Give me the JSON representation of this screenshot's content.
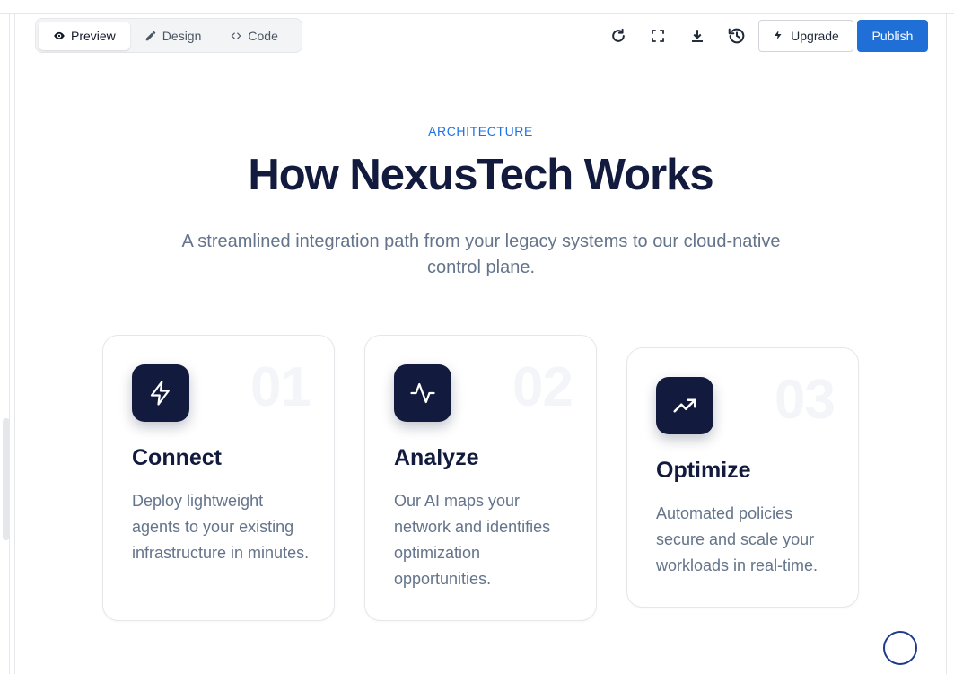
{
  "toolbar": {
    "tabs": [
      {
        "label": "Preview",
        "icon": "eye-icon",
        "active": true
      },
      {
        "label": "Design",
        "icon": "pencil-icon",
        "active": false
      },
      {
        "label": "Code",
        "icon": "code-icon",
        "active": false
      }
    ],
    "actions": [
      "refresh-icon",
      "fullscreen-icon",
      "download-icon",
      "history-icon"
    ],
    "upgrade_label": "Upgrade",
    "publish_label": "Publish"
  },
  "section": {
    "eyebrow": "ARCHITECTURE",
    "title": "How NexusTech Works",
    "subtitle": "A streamlined integration path from your legacy systems to our cloud-native control plane."
  },
  "steps": [
    {
      "number": "01",
      "icon": "lightning-icon",
      "title": "Connect",
      "body": "Deploy lightweight agents to your existing infrastructure in minutes."
    },
    {
      "number": "02",
      "icon": "pulse-icon",
      "title": "Analyze",
      "body": "Our AI maps your network and identifies optimization opportunities."
    },
    {
      "number": "03",
      "icon": "trending-up-icon",
      "title": "Optimize",
      "body": "Automated policies secure and scale your workloads in real-time."
    }
  ],
  "colors": {
    "accent": "#1a73e8",
    "heading": "#121a3d",
    "muted": "#64748b",
    "publish": "#1f6fd6"
  }
}
